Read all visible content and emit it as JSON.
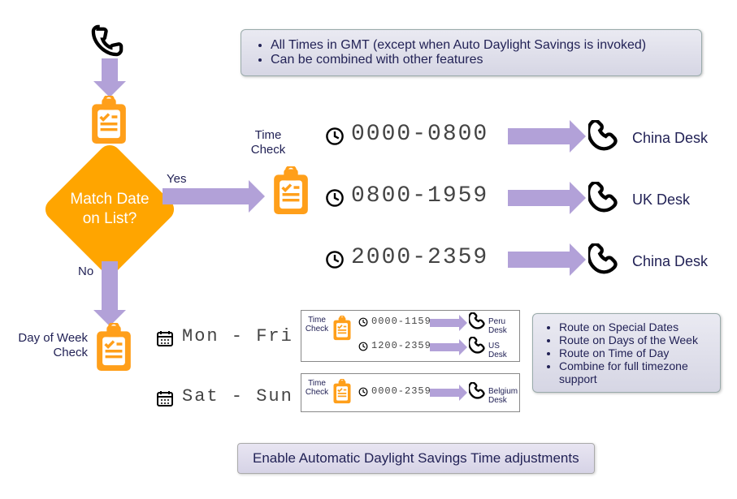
{
  "top_notes": [
    "All Times in GMT (except when Auto Daylight Savings is invoked)",
    "Can be combined with other features"
  ],
  "decision": {
    "line1": "Match Date",
    "line2": "on List?"
  },
  "edge_yes": "Yes",
  "edge_no": "No",
  "time_check_label": "Time\nCheck",
  "dow_check_label": "Day of Week\nCheck",
  "main_routes": [
    {
      "range": "0000-0800",
      "dest": "China Desk"
    },
    {
      "range": "0800-1959",
      "dest": "UK Desk"
    },
    {
      "range": "2000-2359",
      "dest": "China Desk"
    }
  ],
  "dow_rows": [
    {
      "days": "Mon - Fri",
      "routes": [
        {
          "range": "0000-1159",
          "dest": "Peru Desk"
        },
        {
          "range": "1200-2359",
          "dest": "US Desk"
        }
      ]
    },
    {
      "days": "Sat - Sun",
      "routes": [
        {
          "range": "0000-2359",
          "dest": "Belgium Desk"
        }
      ]
    }
  ],
  "right_notes": [
    "Route on Special Dates",
    "Route on Days of the Week",
    "Route on Time of Day",
    "Combine for full timezone support"
  ],
  "footer_button": "Enable Automatic Daylight Savings Time adjustments",
  "mini_time_check": "Time\nCheck"
}
